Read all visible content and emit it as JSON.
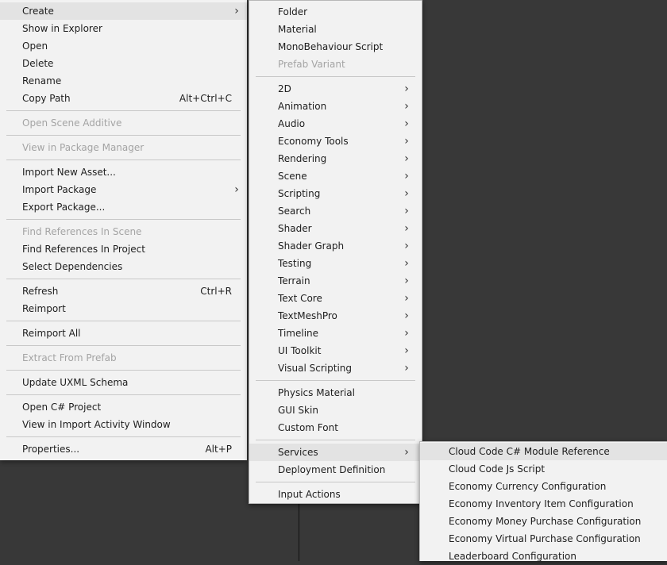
{
  "main_menu": {
    "groups": [
      [
        {
          "label": "Create",
          "submenu": true,
          "highlight": true
        },
        {
          "label": "Show in Explorer"
        },
        {
          "label": "Open"
        },
        {
          "label": "Delete"
        },
        {
          "label": "Rename"
        },
        {
          "label": "Copy Path",
          "shortcut": "Alt+Ctrl+C"
        }
      ],
      [
        {
          "label": "Open Scene Additive",
          "disabled": true
        }
      ],
      [
        {
          "label": "View in Package Manager",
          "disabled": true
        }
      ],
      [
        {
          "label": "Import New Asset..."
        },
        {
          "label": "Import Package",
          "submenu": true
        },
        {
          "label": "Export Package..."
        }
      ],
      [
        {
          "label": "Find References In Scene",
          "disabled": true
        },
        {
          "label": "Find References In Project"
        },
        {
          "label": "Select Dependencies"
        }
      ],
      [
        {
          "label": "Refresh",
          "shortcut": "Ctrl+R"
        },
        {
          "label": "Reimport"
        }
      ],
      [
        {
          "label": "Reimport All"
        }
      ],
      [
        {
          "label": "Extract From Prefab",
          "disabled": true
        }
      ],
      [
        {
          "label": "Update UXML Schema"
        }
      ],
      [
        {
          "label": "Open C# Project"
        },
        {
          "label": "View in Import Activity Window"
        }
      ],
      [
        {
          "label": "Properties...",
          "shortcut": "Alt+P"
        }
      ]
    ]
  },
  "create_menu": {
    "groups": [
      [
        {
          "label": "Folder"
        },
        {
          "label": "Material"
        },
        {
          "label": "MonoBehaviour Script"
        },
        {
          "label": "Prefab Variant",
          "disabled": true
        }
      ],
      [
        {
          "label": "2D",
          "submenu": true
        },
        {
          "label": "Animation",
          "submenu": true
        },
        {
          "label": "Audio",
          "submenu": true
        },
        {
          "label": "Economy Tools",
          "submenu": true
        },
        {
          "label": "Rendering",
          "submenu": true
        },
        {
          "label": "Scene",
          "submenu": true
        },
        {
          "label": "Scripting",
          "submenu": true
        },
        {
          "label": "Search",
          "submenu": true
        },
        {
          "label": "Shader",
          "submenu": true
        },
        {
          "label": "Shader Graph",
          "submenu": true
        },
        {
          "label": "Testing",
          "submenu": true
        },
        {
          "label": "Terrain",
          "submenu": true
        },
        {
          "label": "Text Core",
          "submenu": true
        },
        {
          "label": "TextMeshPro",
          "submenu": true
        },
        {
          "label": "Timeline",
          "submenu": true
        },
        {
          "label": "UI Toolkit",
          "submenu": true
        },
        {
          "label": "Visual Scripting",
          "submenu": true
        }
      ],
      [
        {
          "label": "Physics Material"
        },
        {
          "label": "GUI Skin"
        },
        {
          "label": "Custom Font"
        }
      ],
      [
        {
          "label": "Services",
          "submenu": true,
          "highlight": true
        },
        {
          "label": "Deployment Definition"
        }
      ],
      [
        {
          "label": "Input Actions"
        }
      ]
    ]
  },
  "services_menu": {
    "groups": [
      [
        {
          "label": "Cloud Code C# Module Reference",
          "highlight": true
        },
        {
          "label": "Cloud Code Js Script"
        },
        {
          "label": "Economy Currency Configuration"
        },
        {
          "label": "Economy Inventory Item Configuration"
        },
        {
          "label": "Economy Money Purchase Configuration"
        },
        {
          "label": "Economy Virtual Purchase Configuration"
        },
        {
          "label": "Leaderboard Configuration"
        }
      ]
    ]
  },
  "icons": {
    "submenu_arrow": "chevron-right-icon"
  }
}
